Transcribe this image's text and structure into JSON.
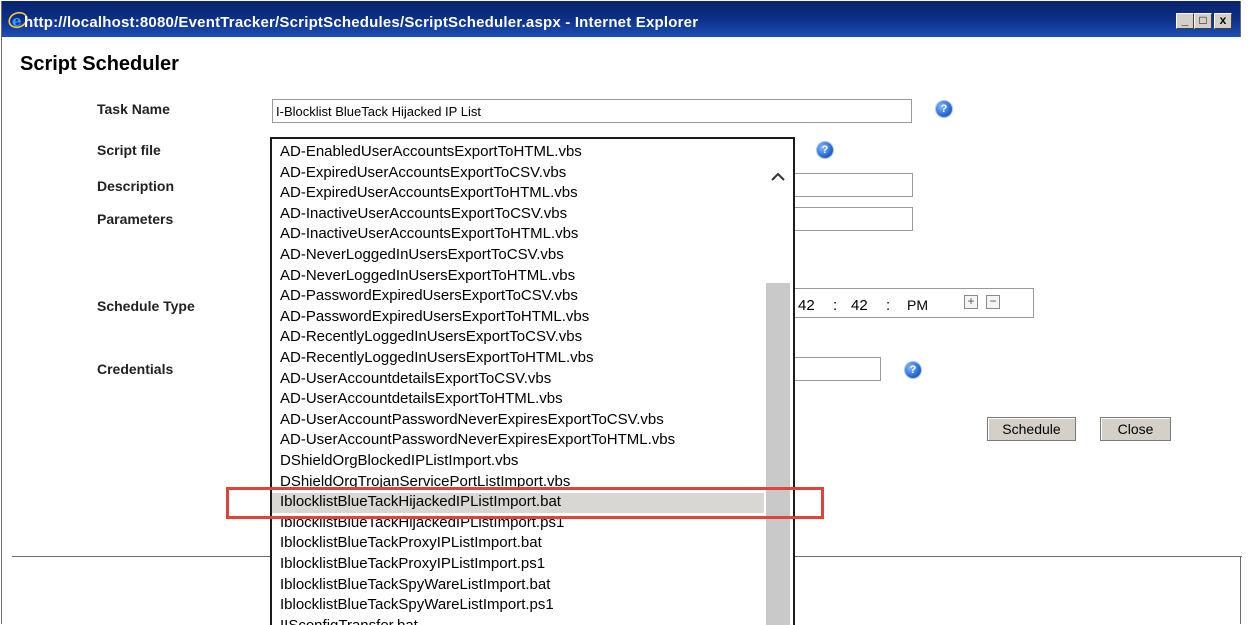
{
  "window": {
    "title": "http://localhost:8080/EventTracker/ScriptSchedules/ScriptScheduler.aspx - Internet Explorer",
    "minimize": "_",
    "maximize": "□",
    "close": "x"
  },
  "page": {
    "title": "Script Scheduler"
  },
  "form": {
    "task_name_label": "Task Name",
    "task_name_value": "I-Blocklist BlueTack Hijacked IP List",
    "script_file_label": "Script file",
    "description_label": "Description",
    "parameters_label": "Parameters",
    "schedule_type_label": "Schedule Type",
    "credentials_label": "Credentials",
    "help_glyph": "?",
    "time": {
      "hour": "42",
      "sep1": ":",
      "minute": "42",
      "sep2": ":",
      "ampm": "PM",
      "increase": "+",
      "decrease": "−"
    },
    "schedule_button": "Schedule",
    "close_button": "Close"
  },
  "script_list": {
    "items": [
      "AD-EnabledUserAccountsExportToHTML.vbs",
      "AD-ExpiredUserAccountsExportToCSV.vbs",
      "AD-ExpiredUserAccountsExportToHTML.vbs",
      "AD-InactiveUserAccountsExportToCSV.vbs",
      "AD-InactiveUserAccountsExportToHTML.vbs",
      "AD-NeverLoggedInUsersExportToCSV.vbs",
      "AD-NeverLoggedInUsersExportToHTML.vbs",
      "AD-PasswordExpiredUsersExportToCSV.vbs",
      "AD-PasswordExpiredUsersExportToHTML.vbs",
      "AD-RecentlyLoggedInUsersExportToCSV.vbs",
      "AD-RecentlyLoggedInUsersExportToHTML.vbs",
      "AD-UserAccountdetailsExportToCSV.vbs",
      "AD-UserAccountdetailsExportToHTML.vbs",
      "AD-UserAccountPasswordNeverExpiresExportToCSV.vbs",
      "AD-UserAccountPasswordNeverExpiresExportToHTML.vbs",
      "DShieldOrgBlockedIPListImport.vbs",
      "DShieldOrgTrojanServicePortListImport.vbs",
      "IblocklistBlueTackHijackedIPListImport.bat",
      "IblocklistBlueTackHijackedIPListImport.ps1",
      "IblocklistBlueTackProxyIPListImport.bat",
      "IblocklistBlueTackProxyIPListImport.ps1",
      "IblocklistBlueTackSpyWareListImport.bat",
      "IblocklistBlueTackSpyWareListImport.ps1",
      "IISconfigTransfer.bat"
    ],
    "selected": "IblocklistBlueTackHijackedIPListImport.bat"
  },
  "colors": {
    "titlebar": "#0a246a",
    "highlight_border": "#e0433c",
    "selection": "#d9d7d4"
  }
}
